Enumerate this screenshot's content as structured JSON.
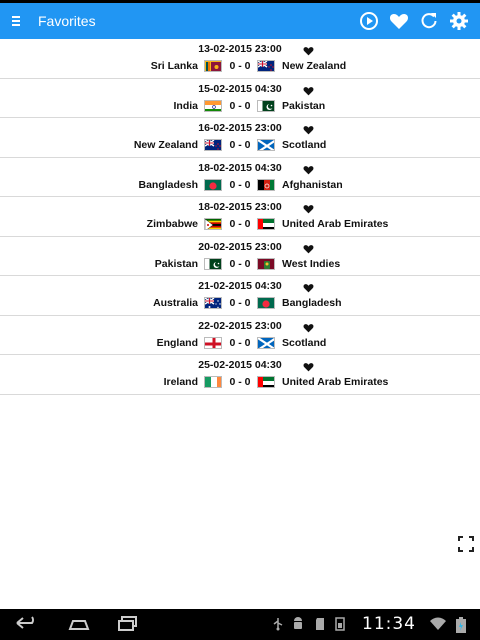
{
  "app": {
    "title": "Favorites"
  },
  "appbar": {
    "actions": [
      "play-circle-icon",
      "heart-icon",
      "refresh-icon",
      "settings-icon"
    ]
  },
  "matches": [
    {
      "datetime": "13-02-2015 23:00",
      "home": "Sri Lanka",
      "score": "0 - 0",
      "away": "New Zealand",
      "home_flag": "sri-lanka",
      "away_flag": "new-zealand"
    },
    {
      "datetime": "15-02-2015 04:30",
      "home": "India",
      "score": "0 - 0",
      "away": "Pakistan",
      "home_flag": "india",
      "away_flag": "pakistan"
    },
    {
      "datetime": "16-02-2015 23:00",
      "home": "New Zealand",
      "score": "0 - 0",
      "away": "Scotland",
      "home_flag": "new-zealand",
      "away_flag": "scotland"
    },
    {
      "datetime": "18-02-2015 04:30",
      "home": "Bangladesh",
      "score": "0 - 0",
      "away": "Afghanistan",
      "home_flag": "bangladesh",
      "away_flag": "afghanistan"
    },
    {
      "datetime": "18-02-2015 23:00",
      "home": "Zimbabwe",
      "score": "0 - 0",
      "away": "United Arab Emirates",
      "home_flag": "zimbabwe",
      "away_flag": "uae"
    },
    {
      "datetime": "20-02-2015 23:00",
      "home": "Pakistan",
      "score": "0 - 0",
      "away": "West Indies",
      "home_flag": "pakistan",
      "away_flag": "west-indies"
    },
    {
      "datetime": "21-02-2015 04:30",
      "home": "Australia",
      "score": "0 - 0",
      "away": "Bangladesh",
      "home_flag": "australia",
      "away_flag": "bangladesh"
    },
    {
      "datetime": "22-02-2015 23:00",
      "home": "England",
      "score": "0 - 0",
      "away": "Scotland",
      "home_flag": "england",
      "away_flag": "scotland"
    },
    {
      "datetime": "25-02-2015 04:30",
      "home": "Ireland",
      "score": "0 - 0",
      "away": "United Arab Emirates",
      "home_flag": "ireland",
      "away_flag": "uae"
    }
  ],
  "system": {
    "clock": "11:34"
  },
  "colors": {
    "appbar": "#2196f3",
    "accent": "#2196f3"
  }
}
